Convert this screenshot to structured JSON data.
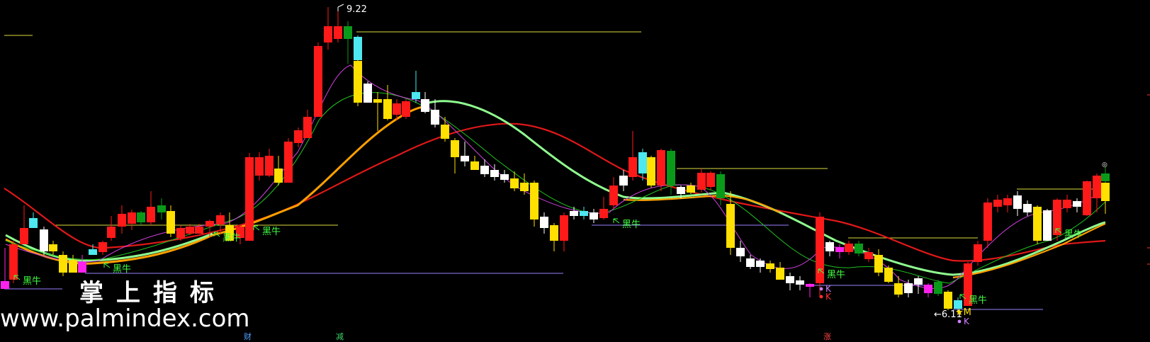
{
  "watermark": {
    "cn": "掌上指标",
    "url": "www.palmindex.com"
  },
  "bottom_markers": [
    {
      "label": "财",
      "color": "#4fa3ff"
    },
    {
      "label": "减",
      "color": "#3fd66a"
    },
    {
      "label": "涨",
      "color": "#ff4444"
    }
  ],
  "chart_data": {
    "type": "candlestick",
    "price_range": [
      5.6,
      9.4
    ],
    "high_label": "9.22",
    "low_label": "6.11",
    "signal_label": "黑牛",
    "signal_count": 10,
    "k_label": "K",
    "m_label": "M",
    "colors": {
      "up": "#ff1a1a",
      "down_white": "#ffffff",
      "down_yellow": "#ffe000",
      "flat_green": "#0a9a1a",
      "cyan": "#4de8f0",
      "magenta": "#ff22ee",
      "ma_red": "#e01818",
      "ma_orange": "#ffa000",
      "ma_lightgreen": "#90ff90",
      "ma_green": "#20c020",
      "ma_magenta": "#d040e0",
      "signal": "#40ff40",
      "hline_yellow": "#dddd40",
      "hline_purple": "#9a80ff"
    }
  }
}
